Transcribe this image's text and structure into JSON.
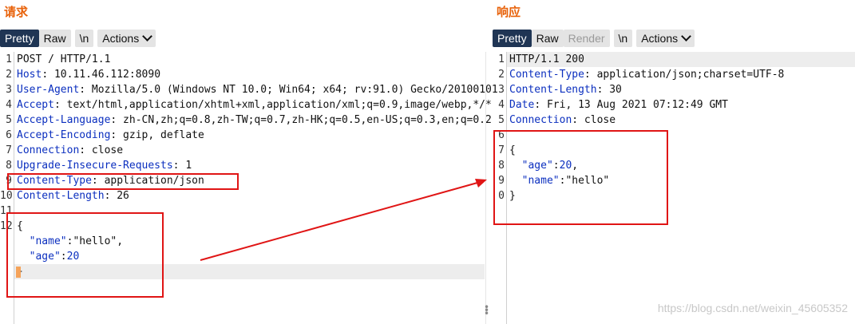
{
  "request": {
    "title": "请求",
    "toolbar": {
      "pretty": "Pretty",
      "raw": "Raw",
      "newline": "\\n",
      "actions": "Actions"
    },
    "lines": [
      {
        "n": "1",
        "name": "",
        "rest": "POST / HTTP/1.1"
      },
      {
        "n": "2",
        "name": "Host",
        "rest": ": 10.11.46.112:8090"
      },
      {
        "n": "3",
        "name": "User-Agent",
        "rest": ": Mozilla/5.0 (Windows NT 10.0; Win64; x64; rv:91.0) Gecko/20100101"
      },
      {
        "n": "4",
        "name": "Accept",
        "rest": ": text/html,application/xhtml+xml,application/xml;q=0.9,image/webp,*/*"
      },
      {
        "n": "5",
        "name": "Accept-Language",
        "rest": ": zh-CN,zh;q=0.8,zh-TW;q=0.7,zh-HK;q=0.5,en-US;q=0.3,en;q=0.2"
      },
      {
        "n": "6",
        "name": "Accept-Encoding",
        "rest": ": gzip, deflate"
      },
      {
        "n": "7",
        "name": "Connection",
        "rest": ": close"
      },
      {
        "n": "8",
        "name": "Upgrade-Insecure-Requests",
        "rest": ": 1"
      },
      {
        "n": "9",
        "name": "Content-Type",
        "rest": ": application/json"
      },
      {
        "n": "10",
        "name": "Content-Length",
        "rest": ": 26"
      },
      {
        "n": "11",
        "name": "",
        "rest": ""
      },
      {
        "n": "12",
        "name": "",
        "rest": "{"
      },
      {
        "n": "",
        "name": "",
        "rest": "  ",
        "key": "\"name\"",
        "sep": ":",
        "val": "\"hello\"",
        "tail": ","
      },
      {
        "n": "",
        "name": "",
        "rest": "  ",
        "key": "\"age\"",
        "sep": ":",
        "num": "20",
        "tail": ""
      },
      {
        "n": "",
        "name": "",
        "rest": "}"
      }
    ]
  },
  "response": {
    "title": "响应",
    "toolbar": {
      "pretty": "Pretty",
      "raw": "Raw",
      "render": "Render",
      "newline": "\\n",
      "actions": "Actions"
    },
    "lines": [
      {
        "n": "1",
        "name": "",
        "rest": "HTTP/1.1 200"
      },
      {
        "n": "2",
        "name": "Content-Type",
        "rest": ": application/json;charset=UTF-8"
      },
      {
        "n": "3",
        "name": "Content-Length",
        "rest": ": 30"
      },
      {
        "n": "4",
        "name": "Date",
        "rest": ": Fri, 13 Aug 2021 07:12:49 GMT"
      },
      {
        "n": "5",
        "name": "Connection",
        "rest": ": close"
      },
      {
        "n": "6",
        "name": "",
        "rest": ""
      },
      {
        "n": "7",
        "name": "",
        "rest": "{"
      },
      {
        "n": "8",
        "name": "",
        "rest": "  ",
        "key": "\"age\"",
        "sep": ":",
        "num": "20",
        "tail": ","
      },
      {
        "n": "9",
        "name": "",
        "rest": "  ",
        "key": "\"name\"",
        "sep": ":",
        "val": "\"hello\"",
        "tail": ""
      },
      {
        "n": "0",
        "name": "",
        "rest": "}"
      }
    ]
  },
  "watermark": "https://blog.csdn.net/weixin_45605352",
  "colors": {
    "accent_title": "#e8620a",
    "header_name": "#0b2fbf",
    "annotation": "#e01515",
    "active_tab": "#1f3554"
  }
}
